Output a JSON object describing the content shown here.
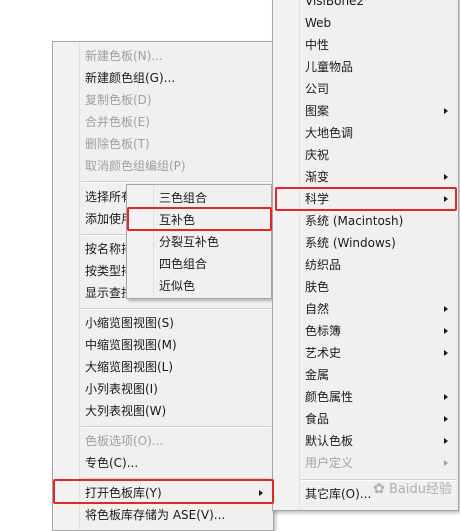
{
  "main_menu": {
    "items": [
      {
        "label": "新建色板(N)...",
        "disabled": true
      },
      {
        "label": "新建颜色组(G)...",
        "disabled": false
      },
      {
        "label": "复制色板(D)",
        "disabled": true
      },
      {
        "label": "合并色板(E)",
        "disabled": true
      },
      {
        "label": "删除色板(T)",
        "disabled": true
      },
      {
        "label": "取消颜色组编组(P)",
        "disabled": true
      },
      {
        "label": "选择所有",
        "disabled": false
      },
      {
        "label": "添加使用",
        "disabled": false
      },
      {
        "label": "按名称排",
        "disabled": false
      },
      {
        "label": "按类型排",
        "disabled": false
      },
      {
        "label": "显示查找",
        "disabled": false
      },
      {
        "label": "小缩览图视图(S)",
        "disabled": false
      },
      {
        "label": "中缩览图视图(M)",
        "disabled": false
      },
      {
        "label": "大缩览图视图(L)",
        "disabled": false
      },
      {
        "label": "小列表视图(I)",
        "disabled": false
      },
      {
        "label": "大列表视图(W)",
        "disabled": false
      },
      {
        "label": "色板选项(O)...",
        "disabled": true
      },
      {
        "label": "专色(C)...",
        "disabled": false
      },
      {
        "label": "打开色板库(Y)",
        "disabled": false
      },
      {
        "label": "将色板库存储为 ASE(V)...",
        "disabled": false
      }
    ]
  },
  "harmony_menu": {
    "items": [
      {
        "label": "三色组合"
      },
      {
        "label": "互补色"
      },
      {
        "label": "分裂互补色"
      },
      {
        "label": "四色组合"
      },
      {
        "label": "近似色"
      }
    ]
  },
  "library_menu": {
    "items": [
      {
        "label": "VisiBone2"
      },
      {
        "label": "Web"
      },
      {
        "label": "中性"
      },
      {
        "label": "儿童物品"
      },
      {
        "label": "公司"
      },
      {
        "label": "图案"
      },
      {
        "label": "大地色调"
      },
      {
        "label": "庆祝"
      },
      {
        "label": "渐变"
      },
      {
        "label": "科学"
      },
      {
        "label": "系统 (Macintosh)"
      },
      {
        "label": "系统 (Windows)"
      },
      {
        "label": "纺织品"
      },
      {
        "label": "肤色"
      },
      {
        "label": "自然"
      },
      {
        "label": "色标簿"
      },
      {
        "label": "艺术史"
      },
      {
        "label": "金属"
      },
      {
        "label": "颜色属性"
      },
      {
        "label": "食品"
      },
      {
        "label": "默认色板"
      },
      {
        "label": "用户定义",
        "disabled": true
      },
      {
        "label": "其它库(O)..."
      }
    ]
  },
  "watermark": {
    "text": "Baidu经验"
  },
  "highlight_color": "#e3262a"
}
